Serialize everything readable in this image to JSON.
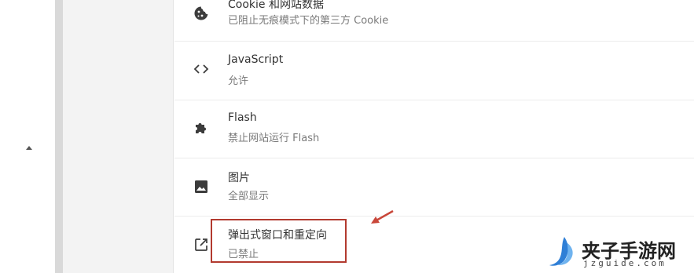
{
  "settings": {
    "items": [
      {
        "key": "cookies",
        "icon": "cookie-icon",
        "title": "Cookie 和网站数据",
        "subtitle": "已阻止无痕模式下的第三方 Cookie"
      },
      {
        "key": "javascript",
        "icon": "code-brackets-icon",
        "title": "JavaScript",
        "subtitle": "允许"
      },
      {
        "key": "flash",
        "icon": "puzzle-piece-icon",
        "title": "Flash",
        "subtitle": "禁止网站运行 Flash"
      },
      {
        "key": "images",
        "icon": "image-icon",
        "title": "图片",
        "subtitle": "全部显示"
      },
      {
        "key": "popups",
        "icon": "open-in-new-icon",
        "title": "弹出式窗口和重定向",
        "subtitle": "已禁止"
      }
    ]
  },
  "annotation": {
    "color": "#b23a2f",
    "arrow_color": "#c9473a"
  },
  "watermark": {
    "title": "夹子手游网",
    "url": "jzguide.com",
    "logo_color": "#2f7fd6"
  }
}
